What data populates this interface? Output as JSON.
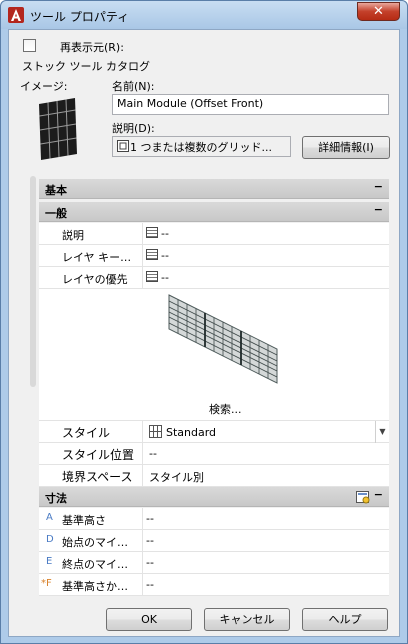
{
  "window": {
    "title": "ツール プロパティ",
    "close_label": "✕"
  },
  "redisplay": {
    "label": "再表示元(R):",
    "value": "ストック ツール カタログ"
  },
  "image_label": "イメージ:",
  "name": {
    "label": "名前(N):",
    "value": "Main Module (Offset Front)"
  },
  "description": {
    "label": "説明(D):",
    "value": "1 つまたは複数のグリッド..."
  },
  "details_button": "詳細情報(I)",
  "sections": {
    "basic": "基本",
    "general": "一般",
    "dimensions": "寸法",
    "collapse_glyph": "−"
  },
  "general_props": [
    {
      "name": "説明",
      "value": "--"
    },
    {
      "name": "レイヤ キー…",
      "value": "--"
    },
    {
      "name": "レイヤの優先",
      "value": "--"
    }
  ],
  "browse_label": "検索...",
  "style_props": [
    {
      "name": "スタイル",
      "value": "Standard"
    },
    {
      "name": "スタイル位置",
      "value": "--"
    },
    {
      "name": "境界スペース",
      "value": "スタイル別"
    }
  ],
  "dimension_props": [
    {
      "marker": "A",
      "name": "基準高さ",
      "value": "--"
    },
    {
      "marker": "D",
      "name": "始点のマイ…",
      "value": "--"
    },
    {
      "marker": "E",
      "name": "終点のマイ…",
      "value": "--"
    },
    {
      "marker": "*F",
      "name": "基準高さか…",
      "value": "--"
    }
  ],
  "buttons": {
    "ok": "OK",
    "cancel": "キャンセル",
    "help": "ヘルプ"
  },
  "colors": {
    "accent": "#aecbe9",
    "close": "#c4402a",
    "marker": "#4a7bc4"
  }
}
